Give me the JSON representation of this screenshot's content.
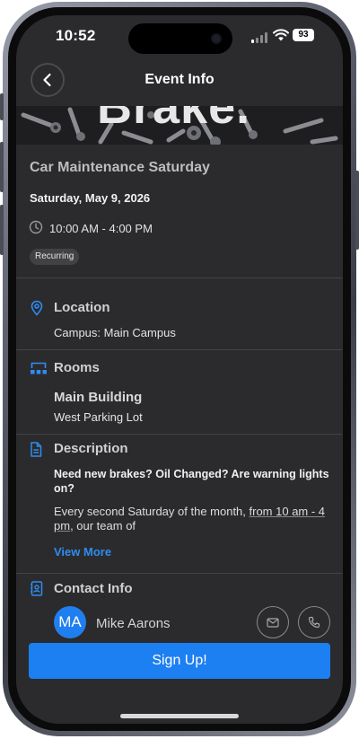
{
  "status_bar": {
    "time": "10:52",
    "battery": "93"
  },
  "header": {
    "title": "Event Info",
    "back_icon": "chevron-left-icon"
  },
  "banner": {
    "text": "Brake."
  },
  "event": {
    "title": "Car Maintenance Saturday",
    "date": "Saturday, May 9, 2026",
    "time": "10:00 AM - 4:00 PM",
    "badge": "Recurring"
  },
  "location": {
    "title": "Location",
    "value": "Campus: Main Campus"
  },
  "rooms": {
    "title": "Rooms",
    "building": "Main Building",
    "room": "West Parking Lot"
  },
  "description": {
    "title": "Description",
    "headline": "Need new brakes? Oil Changed? Are warning lights on?",
    "body_start": "Every second Saturday of the month, ",
    "body_underlined": "from 10 am - 4 pm",
    "body_end": ", our team of",
    "view_more": "View More"
  },
  "contact": {
    "title": "Contact Info",
    "initials": "MA",
    "name": "Mike Aarons"
  },
  "signup": {
    "label": "Sign Up!"
  },
  "colors": {
    "accent": "#1c7ff2",
    "background": "#2b2b2d"
  }
}
